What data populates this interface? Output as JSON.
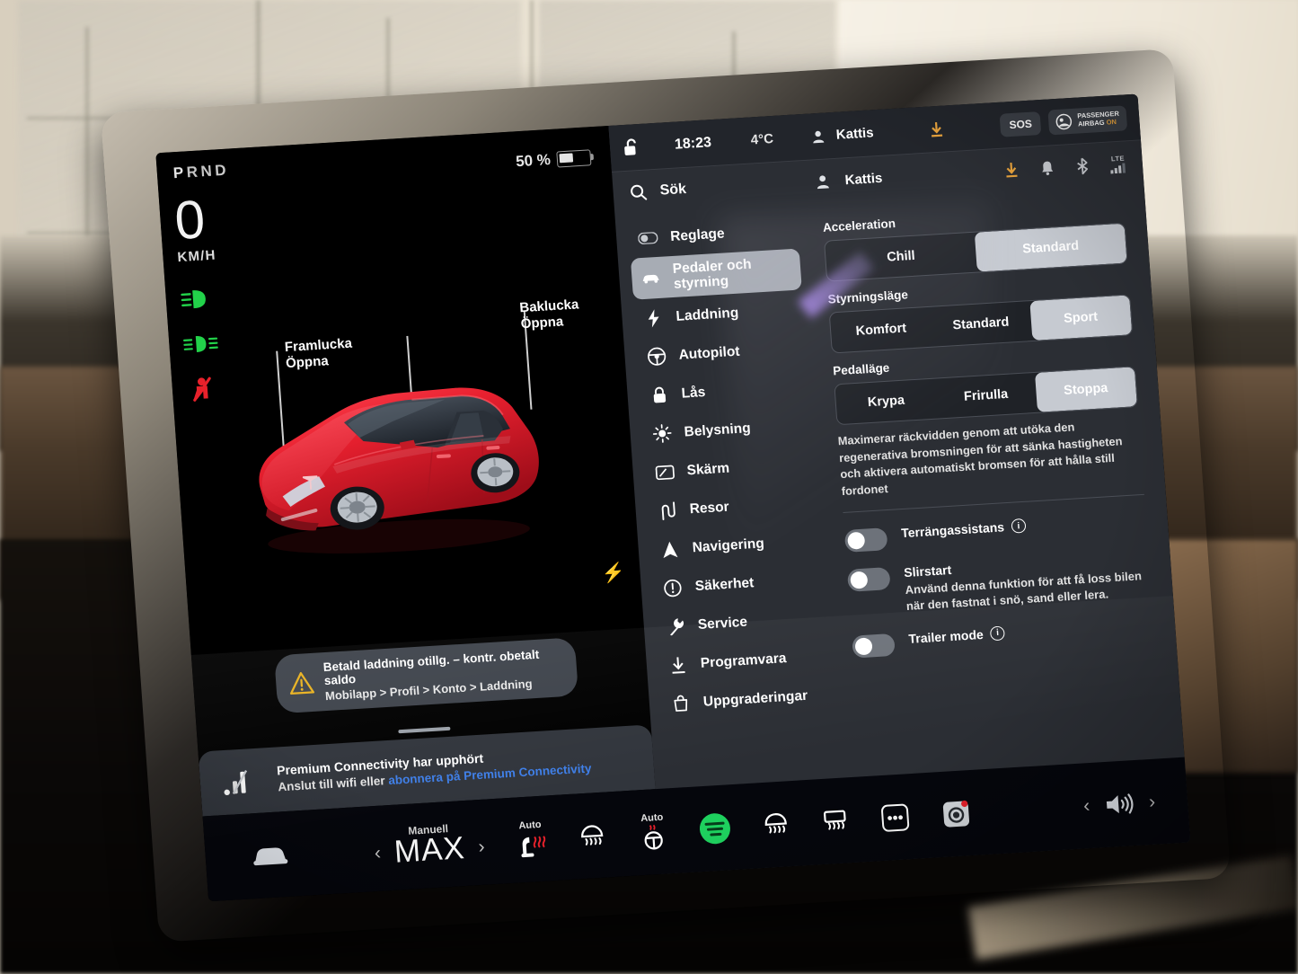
{
  "driver_display": {
    "gear_indicator": "PRND",
    "active_gear": "P",
    "speed_value": "0",
    "speed_unit": "KM/H",
    "battery_percent": "50 %",
    "indicators": [
      {
        "name": "headlights-low-beam-icon",
        "color": "#22d24a"
      },
      {
        "name": "fog-lights-icon",
        "color": "#22d24a"
      },
      {
        "name": "seatbelt-warning-icon",
        "color": "#e8212b"
      }
    ],
    "callouts": [
      {
        "name": "front-trunk",
        "title": "Framlucka",
        "action": "Öppna"
      },
      {
        "name": "rear-trunk",
        "title": "Baklucka",
        "action": "Öppna"
      }
    ],
    "car_color": "#e8202f",
    "lock_state": "unlocked"
  },
  "warning_pill": {
    "icon": "warning-triangle-icon",
    "line1": "Betald laddning otillg. – kontr. obetalt saldo",
    "line2": "Mobilapp > Profil > Konto > Laddning",
    "icon_color": "#e8b120"
  },
  "connectivity_banner": {
    "icon": "cellular-signal-icon",
    "title": "Premium Connectivity har upphört",
    "subtitle_prefix": "Anslut till wifi eller ",
    "subtitle_link": "abonnera på Premium Connectivity",
    "link_color": "#3f7fe8"
  },
  "climate_bar": {
    "car_icon": "car-front-icon",
    "temp_mode": "Manuell",
    "temp_value": "MAX",
    "prev_arrow": "‹",
    "next_arrow": "›",
    "items": [
      {
        "name": "driver-seat-heater-icon",
        "label": "Auto"
      },
      {
        "name": "rear-window-defrost-icon",
        "label": ""
      },
      {
        "name": "steering-wheel-heater-icon",
        "label": "Auto"
      },
      {
        "name": "spotify-icon",
        "label": ""
      },
      {
        "name": "front-defrost-icon",
        "label": ""
      },
      {
        "name": "rear-defrost-icon",
        "label": ""
      },
      {
        "name": "more-apps-icon",
        "label": ""
      },
      {
        "name": "dashcam-icon",
        "label": ""
      }
    ],
    "volume_prev": "‹",
    "volume_icon": "speaker-volume-icon",
    "volume_next": "›"
  },
  "status_bar": {
    "lock_icon": "unlocked-padlock-icon",
    "time": "18:23",
    "temperature": "4°C",
    "profile": "Kattis",
    "download_icon": "download-arrow-icon",
    "sos_label": "SOS",
    "airbag_line1": "PASSENGER",
    "airbag_line2": "AIRBAG",
    "airbag_status": "ON",
    "airbag_status_color": "#e8a33d"
  },
  "panel_header": {
    "search_icon": "search-icon",
    "search_label": "Sök",
    "profile_icon": "person-icon",
    "profile_name": "Kattis",
    "icons": [
      {
        "name": "download-arrow-icon",
        "color": "#e8a33d"
      },
      {
        "name": "bell-icon",
        "color": "#c9ccd1"
      },
      {
        "name": "bluetooth-icon",
        "color": "#c9ccd1"
      },
      {
        "name": "lte-signal-icon",
        "color": "#c9ccd1"
      }
    ]
  },
  "sidebar": {
    "items": [
      {
        "label": "Reglage",
        "icon": "toggle-switch-icon",
        "selected": false
      },
      {
        "label": "Pedaler och styrning",
        "icon": "car-icon",
        "selected": true
      },
      {
        "label": "Laddning",
        "icon": "lightning-bolt-icon",
        "selected": false
      },
      {
        "label": "Autopilot",
        "icon": "steering-wheel-icon",
        "selected": false
      },
      {
        "label": "Lås",
        "icon": "padlock-icon",
        "selected": false
      },
      {
        "label": "Belysning",
        "icon": "sun-brightness-icon",
        "selected": false
      },
      {
        "label": "Skärm",
        "icon": "display-icon",
        "selected": false
      },
      {
        "label": "Resor",
        "icon": "trip-route-icon",
        "selected": false
      },
      {
        "label": "Navigering",
        "icon": "navigation-arrow-icon",
        "selected": false
      },
      {
        "label": "Säkerhet",
        "icon": "exclamation-circle-icon",
        "selected": false
      },
      {
        "label": "Service",
        "icon": "wrench-icon",
        "selected": false
      },
      {
        "label": "Programvara",
        "icon": "download-icon",
        "selected": false
      },
      {
        "label": "Uppgraderingar",
        "icon": "upgrade-bag-icon",
        "selected": false
      }
    ]
  },
  "detail": {
    "groups": [
      {
        "name": "acceleration",
        "title": "Acceleration",
        "options": [
          "Chill",
          "Standard"
        ],
        "selected": "Standard"
      },
      {
        "name": "steering-mode",
        "title": "Styrningsläge",
        "options": [
          "Komfort",
          "Standard",
          "Sport"
        ],
        "selected": "Sport"
      },
      {
        "name": "pedal-mode",
        "title": "Pedalläge",
        "options": [
          "Krypa",
          "Frirulla",
          "Stoppa"
        ],
        "selected": "Stoppa"
      }
    ],
    "pedal_description": "Maximerar räckvidden genom att utöka den regenerativa bromsningen för att sänka hastigheten och aktivera automatiskt bromsen för att hålla still fordonet",
    "toggles": [
      {
        "name": "offroad-assist",
        "label": "Terrängassistans",
        "has_info": true,
        "description": "",
        "on": false
      },
      {
        "name": "slip-start",
        "label": "Slirstart",
        "has_info": false,
        "description": "Använd denna funktion för att få loss bilen när den fastnat i snö, sand eller lera.",
        "on": false
      },
      {
        "name": "trailer-mode",
        "label": "Trailer mode",
        "has_info": true,
        "description": "",
        "on": false
      }
    ]
  }
}
